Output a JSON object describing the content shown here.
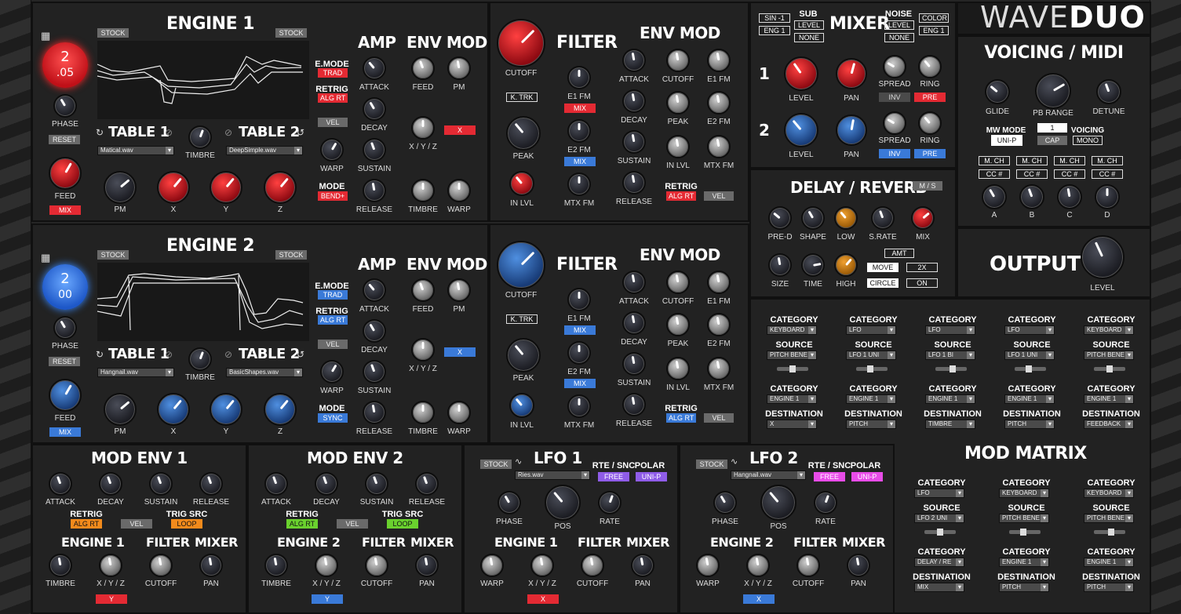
{
  "logo": {
    "thin": "WAVE",
    "bold": "DUO"
  },
  "engines": [
    {
      "title": "ENGINE 1",
      "stock_left": "STOCK",
      "stock_right": "STOCK",
      "osc_top": "2",
      "osc_bottom": ".05",
      "phase": "PHASE",
      "reset": "RESET",
      "feed": "FEED",
      "feed_tag": "MIX",
      "table1": "TABLE 1",
      "table2": "TABLE 2",
      "file1": "Matical.wav",
      "file2": "DeepSimple.wav",
      "timbre": "TIMBRE",
      "pm": "PM",
      "x": "X",
      "y": "Y",
      "z": "Z",
      "emode": "E.MODE",
      "emode_val": "TRAD",
      "retrig": "RETRIG",
      "retrig_val": "ALG RT",
      "vel": "VEL",
      "warp": "WARP",
      "mode": "MODE",
      "mode_val": "BEND+",
      "amp": "AMP",
      "attack": "ATTACK",
      "decay": "DECAY",
      "sustain": "SUSTAIN",
      "release": "RELEASE",
      "envmod": "ENV MOD",
      "em_feed": "FEED",
      "em_pm": "PM",
      "em_xyz": "X / Y / Z",
      "em_x": "X",
      "em_timbre": "TIMBRE",
      "em_warp": "WARP",
      "filter": "FILTER",
      "cutoff": "CUTOFF",
      "ktrk": "K. TRK",
      "e1fm": "E1 FM",
      "e1fm_tag": "MIX",
      "e2fm": "E2 FM",
      "e2fm_tag": "MIX",
      "peak": "PEAK",
      "inlvl": "IN LVL",
      "mtxfm": "MTX FM",
      "fenv": "ENV MOD",
      "fe_attack": "ATTACK",
      "fe_cutoff": "CUTOFF",
      "fe_e1fm": "E1 FM",
      "fe_decay": "DECAY",
      "fe_peak": "PEAK",
      "fe_e2fm": "E2 FM",
      "fe_sustain": "SUSTAIN",
      "fe_inlvl": "IN LVL",
      "fe_mtxfm": "MTX FM",
      "fe_release": "RELEASE",
      "fe_retrig": "RETRIG",
      "fe_retrig_val": "ALG RT",
      "fe_vel": "VEL"
    },
    {
      "title": "ENGINE 2",
      "stock_left": "STOCK",
      "stock_right": "STOCK",
      "osc_top": "2",
      "osc_bottom": "00",
      "phase": "PHASE",
      "reset": "RESET",
      "feed": "FEED",
      "feed_tag": "MIX",
      "table1": "TABLE 1",
      "table2": "TABLE 2",
      "file1": "Hangnail.wav",
      "file2": "BasicShapes.wav",
      "timbre": "TIMBRE",
      "pm": "PM",
      "x": "X",
      "y": "Y",
      "z": "Z",
      "emode": "E.MODE",
      "emode_val": "TRAD",
      "retrig": "RETRIG",
      "retrig_val": "ALG RT",
      "vel": "VEL",
      "warp": "WARP",
      "mode": "MODE",
      "mode_val": "SYNC",
      "amp": "AMP",
      "attack": "ATTACK",
      "decay": "DECAY",
      "sustain": "SUSTAIN",
      "release": "RELEASE",
      "envmod": "ENV MOD",
      "em_feed": "FEED",
      "em_pm": "PM",
      "em_xyz": "X / Y / Z",
      "em_x": "X",
      "em_timbre": "TIMBRE",
      "em_warp": "WARP",
      "filter": "FILTER",
      "cutoff": "CUTOFF",
      "ktrk": "K. TRK",
      "e1fm": "E1 FM",
      "e1fm_tag": "MIX",
      "e2fm": "E2 FM",
      "e2fm_tag": "MIX",
      "peak": "PEAK",
      "inlvl": "IN LVL",
      "mtxfm": "MTX FM",
      "fenv": "ENV MOD",
      "fe_attack": "ATTACK",
      "fe_cutoff": "CUTOFF",
      "fe_e1fm": "E1 FM",
      "fe_decay": "DECAY",
      "fe_peak": "PEAK",
      "fe_e2fm": "E2 FM",
      "fe_sustain": "SUSTAIN",
      "fe_inlvl": "IN LVL",
      "fe_mtxfm": "MTX FM",
      "fe_release": "RELEASE",
      "fe_retrig": "RETRIG",
      "fe_retrig_val": "ALG RT",
      "fe_vel": "VEL"
    }
  ],
  "mixer": {
    "sin": "SIN -1",
    "eng1a": "ENG 1",
    "sub": "SUB",
    "sub_level": "LEVEL",
    "sub_none": "NONE",
    "title": "MIXER",
    "noise": "NOISE",
    "noise_level": "LEVEL",
    "noise_none": "NONE",
    "color": "COLOR",
    "eng1b": "ENG 1",
    "row1": "1",
    "row2": "2",
    "level": "LEVEL",
    "pan": "PAN",
    "spread": "SPREAD",
    "ring": "RING",
    "inv": "INV",
    "pre": "PRE"
  },
  "voicing": {
    "title": "VOICING / MIDI",
    "glide": "GLIDE",
    "pbrange": "PB RANGE",
    "detune": "DETUNE",
    "mwmode": "MW MODE",
    "mwmode_val": "UNI-P",
    "pb_val": "1",
    "cap": "CAP",
    "voicing": "VOICING",
    "voicing_val": "MONO",
    "mch": "M. CH",
    "cc": "CC #",
    "a": "A",
    "b": "B",
    "c": "C",
    "d": "D"
  },
  "delay": {
    "title": "DELAY / REVERB",
    "ms": "M / S",
    "pred": "PRE-D",
    "shape": "SHAPE",
    "low": "LOW",
    "srate": "S.RATE",
    "mix": "MIX",
    "size": "SIZE",
    "time": "TIME",
    "high": "HIGH",
    "amt": "AMT",
    "move": "MOVE",
    "x2": "2X",
    "circle": "CIRCLE",
    "on": "ON"
  },
  "output": {
    "title": "OUTPUT",
    "level": "LEVEL"
  },
  "matrix": {
    "title": "MOD MATRIX",
    "category": "CATEGORY",
    "source": "SOURCE",
    "destination": "DESTINATION",
    "top": [
      {
        "cat1": "KEYBOARD",
        "src": "PITCH BENE",
        "cat2": "ENGINE 1",
        "dst": "X"
      },
      {
        "cat1": "LFO",
        "src": "LFO 1 UNI",
        "cat2": "ENGINE 1",
        "dst": "PITCH"
      },
      {
        "cat1": "LFO",
        "src": "LFO 1 BI",
        "cat2": "ENGINE 1",
        "dst": "TIMBRE"
      },
      {
        "cat1": "LFO",
        "src": "LFO 1 UNI",
        "cat2": "ENGINE 1",
        "dst": "PITCH"
      },
      {
        "cat1": "KEYBOARD",
        "src": "PITCH BENE",
        "cat2": "ENGINE 1",
        "dst": "FEEDBACK"
      }
    ],
    "bottom": [
      {
        "cat1": "LFO",
        "src": "LFO 2 UNI",
        "cat2": "DELAY / RE",
        "dst": "MIX"
      },
      {
        "cat1": "KEYBOARD",
        "src": "PITCH BENE",
        "cat2": "ENGINE 1",
        "dst": "PITCH"
      },
      {
        "cat1": "KEYBOARD",
        "src": "PITCH BENE",
        "cat2": "ENGINE 1",
        "dst": "PITCH"
      }
    ]
  },
  "modenv": [
    {
      "title": "MOD ENV 1",
      "attack": "ATTACK",
      "decay": "DECAY",
      "sustain": "SUSTAIN",
      "release": "RELEASE",
      "retrig": "RETRIG",
      "retrig_val": "ALG RT",
      "vel": "VEL",
      "trig": "TRIG SRC",
      "trig_val": "LOOP",
      "engine": "ENGINE 1",
      "filter": "FILTER",
      "mixer": "MIXER",
      "timbre": "TIMBRE",
      "xyz": "X / Y / Z",
      "cutoff": "CUTOFF",
      "pan": "PAN",
      "tag": "Y"
    },
    {
      "title": "MOD ENV 2",
      "attack": "ATTACK",
      "decay": "DECAY",
      "sustain": "SUSTAIN",
      "release": "RELEASE",
      "retrig": "RETRIG",
      "retrig_val": "ALG RT",
      "vel": "VEL",
      "trig": "TRIG SRC",
      "trig_val": "LOOP",
      "engine": "ENGINE 2",
      "filter": "FILTER",
      "mixer": "MIXER",
      "timbre": "TIMBRE",
      "xyz": "X / Y / Z",
      "cutoff": "CUTOFF",
      "pan": "PAN",
      "tag": "Y"
    }
  ],
  "lfo": [
    {
      "title": "LFO 1",
      "stock": "STOCK",
      "file": "Ries.wav",
      "rte": "RTE / SNC",
      "rte_val": "FREE",
      "polar": "POLAR",
      "polar_val": "UNI-P",
      "phase": "PHASE",
      "pos": "POS",
      "rate": "RATE",
      "engine": "ENGINE 1",
      "filter": "FILTER",
      "mixer": "MIXER",
      "warp": "WARP",
      "xyz": "X / Y / Z",
      "cutoff": "CUTOFF",
      "pan": "PAN",
      "tag": "X"
    },
    {
      "title": "LFO 2",
      "stock": "STOCK",
      "file": "Hangnail.wav",
      "rte": "RTE / SNC",
      "rte_val": "FREE",
      "polar": "POLAR",
      "polar_val": "UNI-P",
      "phase": "PHASE",
      "pos": "POS",
      "rate": "RATE",
      "engine": "ENGINE 2",
      "filter": "FILTER",
      "mixer": "MIXER",
      "warp": "WARP",
      "xyz": "X / Y / Z",
      "cutoff": "CUTOFF",
      "pan": "PAN",
      "tag": "X"
    }
  ],
  "colors": {
    "red": "#e42a33",
    "blue": "#3a7ad8",
    "orange": "#f28a1c",
    "green": "#6ad12e",
    "purple": "#8f5ce8",
    "pink": "#e84ce8"
  }
}
